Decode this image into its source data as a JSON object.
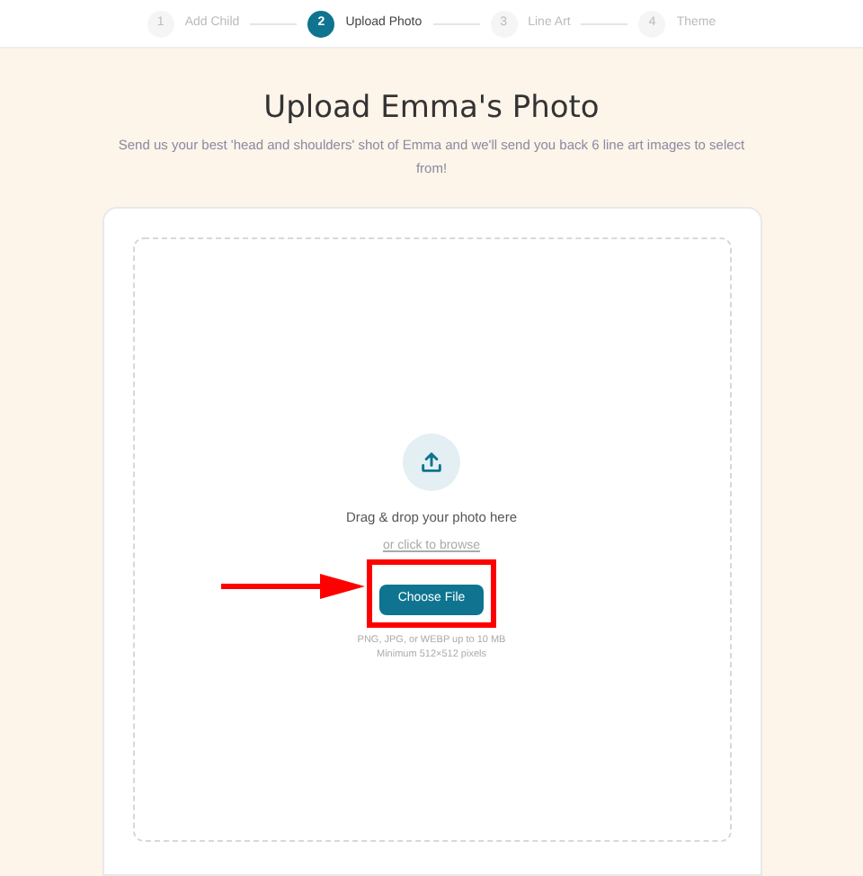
{
  "steps": [
    {
      "number": "1",
      "label": "Add Child",
      "selected": false
    },
    {
      "number": "2",
      "label": "Upload Photo",
      "selected": true
    },
    {
      "number": "3",
      "label": "Line Art",
      "selected": false
    },
    {
      "number": "4",
      "label": "Theme",
      "selected": false
    }
  ],
  "title": "Upload Emma's Photo",
  "subtitle": "Send us your best 'head and shoulders' shot of Emma and we'll send you back 6 line art images to select from!",
  "dropzone": {
    "heading": "Drag & drop your photo here",
    "browse": "or click to browse",
    "button": "Choose File",
    "hints": [
      "PNG, JPG, or WEBP up to 10 MB",
      "Minimum 512×512 pixels"
    ]
  }
}
